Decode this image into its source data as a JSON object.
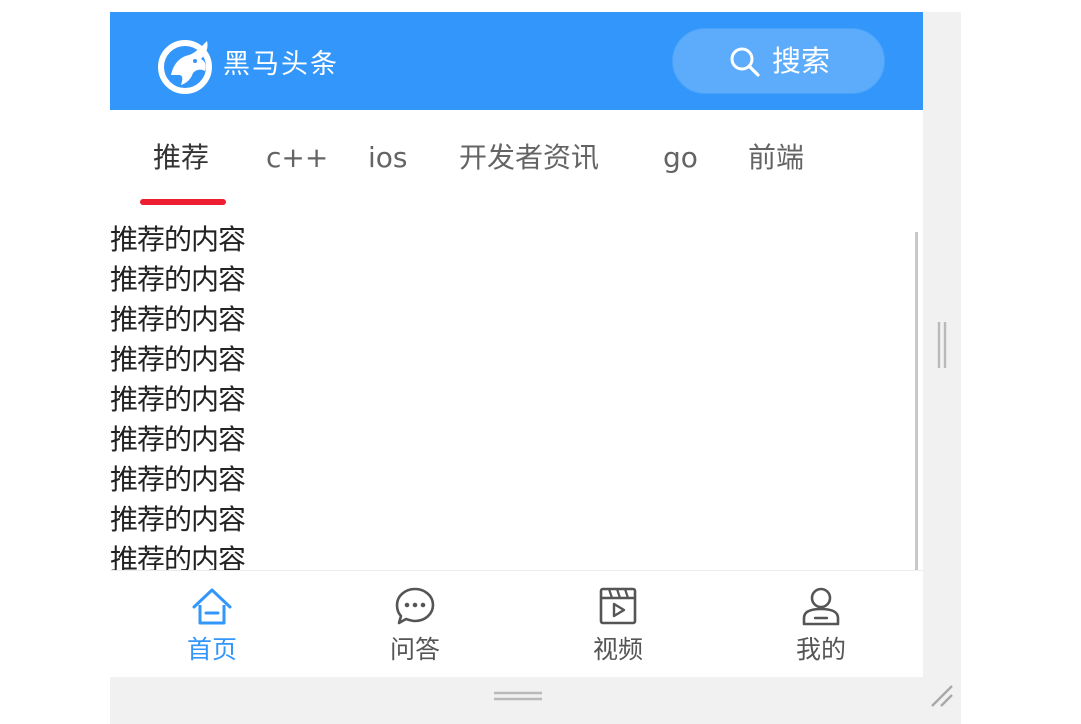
{
  "header": {
    "logo_text": "黑马头条",
    "logo_icon": "horse-logo-icon",
    "search_label": "搜索",
    "search_icon": "search-icon",
    "background_color": "#3296fa"
  },
  "channels": {
    "active_index": 0,
    "underline_color": "#ee1e32",
    "items": [
      {
        "label": "推荐"
      },
      {
        "label": "c++"
      },
      {
        "label": "ios"
      },
      {
        "label": "开发者资讯"
      },
      {
        "label": "go"
      },
      {
        "label": "前端"
      }
    ]
  },
  "content": {
    "lines": [
      "推荐的内容",
      "推荐的内容",
      "推荐的内容",
      "推荐的内容",
      "推荐的内容",
      "推荐的内容",
      "推荐的内容",
      "推荐的内容",
      "推荐的内容"
    ]
  },
  "tabbar": {
    "active_index": 0,
    "active_color": "#3296fa",
    "items": [
      {
        "label": "首页",
        "icon": "home-icon"
      },
      {
        "label": "问答",
        "icon": "chat-bubble-icon"
      },
      {
        "label": "视频",
        "icon": "video-icon"
      },
      {
        "label": "我的",
        "icon": "user-icon"
      }
    ]
  }
}
